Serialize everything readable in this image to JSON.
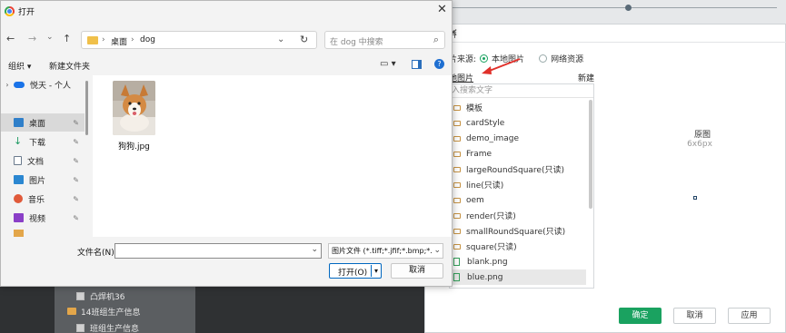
{
  "window": {
    "title": "打开",
    "close_glyph": "✕"
  },
  "nav": {
    "back_glyph": "←",
    "forward_glyph": "→",
    "dropdown_glyph": "⌄",
    "up_glyph": "↑",
    "breadcrumb": [
      "桌面",
      "dog"
    ],
    "breadcrumb_sep": "›",
    "address_dropdown_glyph": "⌄",
    "refresh_glyph": "↻",
    "search_placeholder": "在 dog 中搜索",
    "search_icon_glyph": "⌕"
  },
  "toolbar": {
    "organize_label": "组织 ▾",
    "new_folder_label": "新建文件夹",
    "view_glyph": "▭ ▾",
    "help_glyph": "?"
  },
  "sidebar": {
    "items": [
      {
        "label": "悦天 - 个人",
        "icon": "cloud-icon",
        "color": "#1a73e8",
        "chev": "›",
        "selected": false,
        "pinned": false
      },
      {
        "label": "桌面",
        "icon": "desktop-icon",
        "color": "#2f7fc9",
        "chev": "",
        "selected": true,
        "pinned": true
      },
      {
        "label": "下载",
        "icon": "download-icon",
        "color": "#1d9a62",
        "chev": "",
        "selected": false,
        "pinned": true
      },
      {
        "label": "文档",
        "icon": "document-icon",
        "color": "#6a7a8c",
        "chev": "",
        "selected": false,
        "pinned": true
      },
      {
        "label": "图片",
        "icon": "pictures-icon",
        "color": "#2b87d1",
        "chev": "",
        "selected": false,
        "pinned": true
      },
      {
        "label": "音乐",
        "icon": "music-icon",
        "color": "#e05a3a",
        "chev": "",
        "selected": false,
        "pinned": true
      },
      {
        "label": "视频",
        "icon": "video-icon",
        "color": "#8a3fc7",
        "chev": "",
        "selected": false,
        "pinned": true
      }
    ],
    "pin_glyph": "📌"
  },
  "content": {
    "files": [
      {
        "name": "狗狗.jpg",
        "icon": "corgi-thumbnail"
      }
    ]
  },
  "footer": {
    "filename_label": "文件名(N):",
    "filename_value": "",
    "filetype_value": "图片文件 (*.tiff;*.jfif;*.bmp;*.gi",
    "dropdown_glyph": "⌄",
    "open_label": "打开(O)",
    "open_split_glyph": "▾",
    "cancel_label": "取消"
  },
  "picker": {
    "title": "片",
    "close_glyph": "✕",
    "source_label": "片来源:",
    "source_local": "本地图片",
    "source_web": "网络资源",
    "tab_local": "地图片",
    "tab_new": "新建",
    "search_placeholder": "入搜索文字",
    "files": [
      {
        "name": "模板",
        "type": "folder"
      },
      {
        "name": "cardStyle",
        "type": "folder"
      },
      {
        "name": "demo_image",
        "type": "folder"
      },
      {
        "name": "Frame",
        "type": "folder"
      },
      {
        "name": "largeRoundSquare(只读)",
        "type": "folder"
      },
      {
        "name": "line(只读)",
        "type": "folder"
      },
      {
        "name": "oem",
        "type": "folder"
      },
      {
        "name": "render(只读)",
        "type": "folder"
      },
      {
        "name": "smallRoundSquare(只读)",
        "type": "folder"
      },
      {
        "name": "square(只读)",
        "type": "folder"
      },
      {
        "name": "blank.png",
        "type": "file"
      },
      {
        "name": "blue.png",
        "type": "file"
      }
    ],
    "preview_label": "原图",
    "preview_size": "6x6px",
    "confirm_label": "确定",
    "cancel_label": "取消",
    "apply_label": "应用"
  },
  "background_tree": {
    "rows": [
      {
        "label": "凸焊机36",
        "kind": "check"
      },
      {
        "label": "14班组生产信息",
        "kind": "folder"
      },
      {
        "label": "班组生产信息",
        "kind": "check"
      }
    ]
  },
  "colors": {
    "accent_green": "#1aa260",
    "windows_blue": "#0067c0",
    "annotation_red": "#e0302a"
  }
}
